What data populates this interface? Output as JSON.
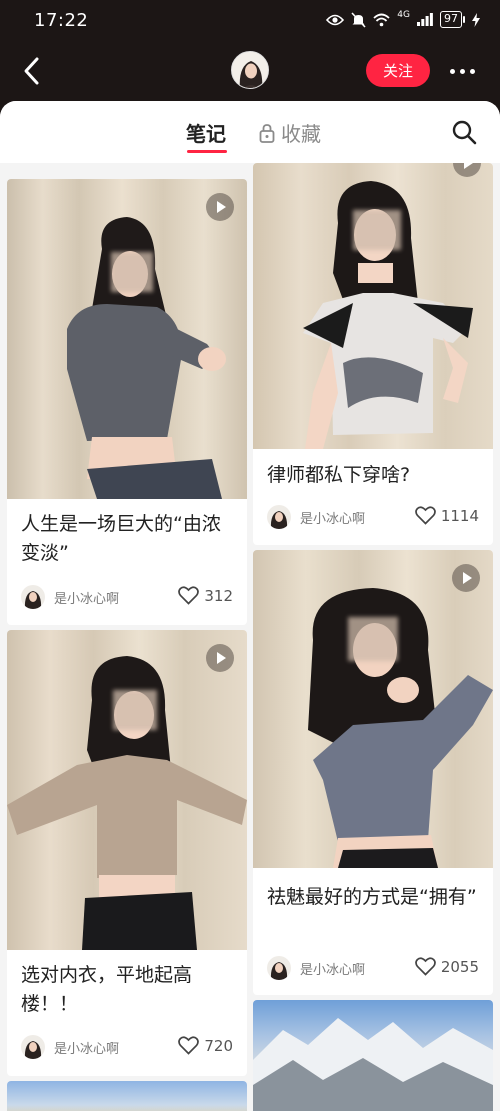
{
  "status_bar": {
    "time": "17:22",
    "signal": "4G",
    "battery": "97"
  },
  "header": {
    "follow_label": "关注"
  },
  "tabs": {
    "notes": "笔记",
    "favorites": "收藏"
  },
  "notes": [
    {
      "title": "人生是一场巨大的“由浓变淡”",
      "author": "是小冰心啊",
      "likes": "312"
    },
    {
      "title": "律师都私下穿啥?",
      "author": "是小冰心啊",
      "likes": "1114"
    },
    {
      "title": "选对内衣，平地起高楼！！",
      "author": "是小冰心啊",
      "likes": "720"
    },
    {
      "title": "祛魅最好的方式是“拥有”",
      "author": "是小冰心啊",
      "likes": "2055"
    }
  ],
  "colors": {
    "accent": "#ff2442",
    "topbar": "#1c1615"
  }
}
